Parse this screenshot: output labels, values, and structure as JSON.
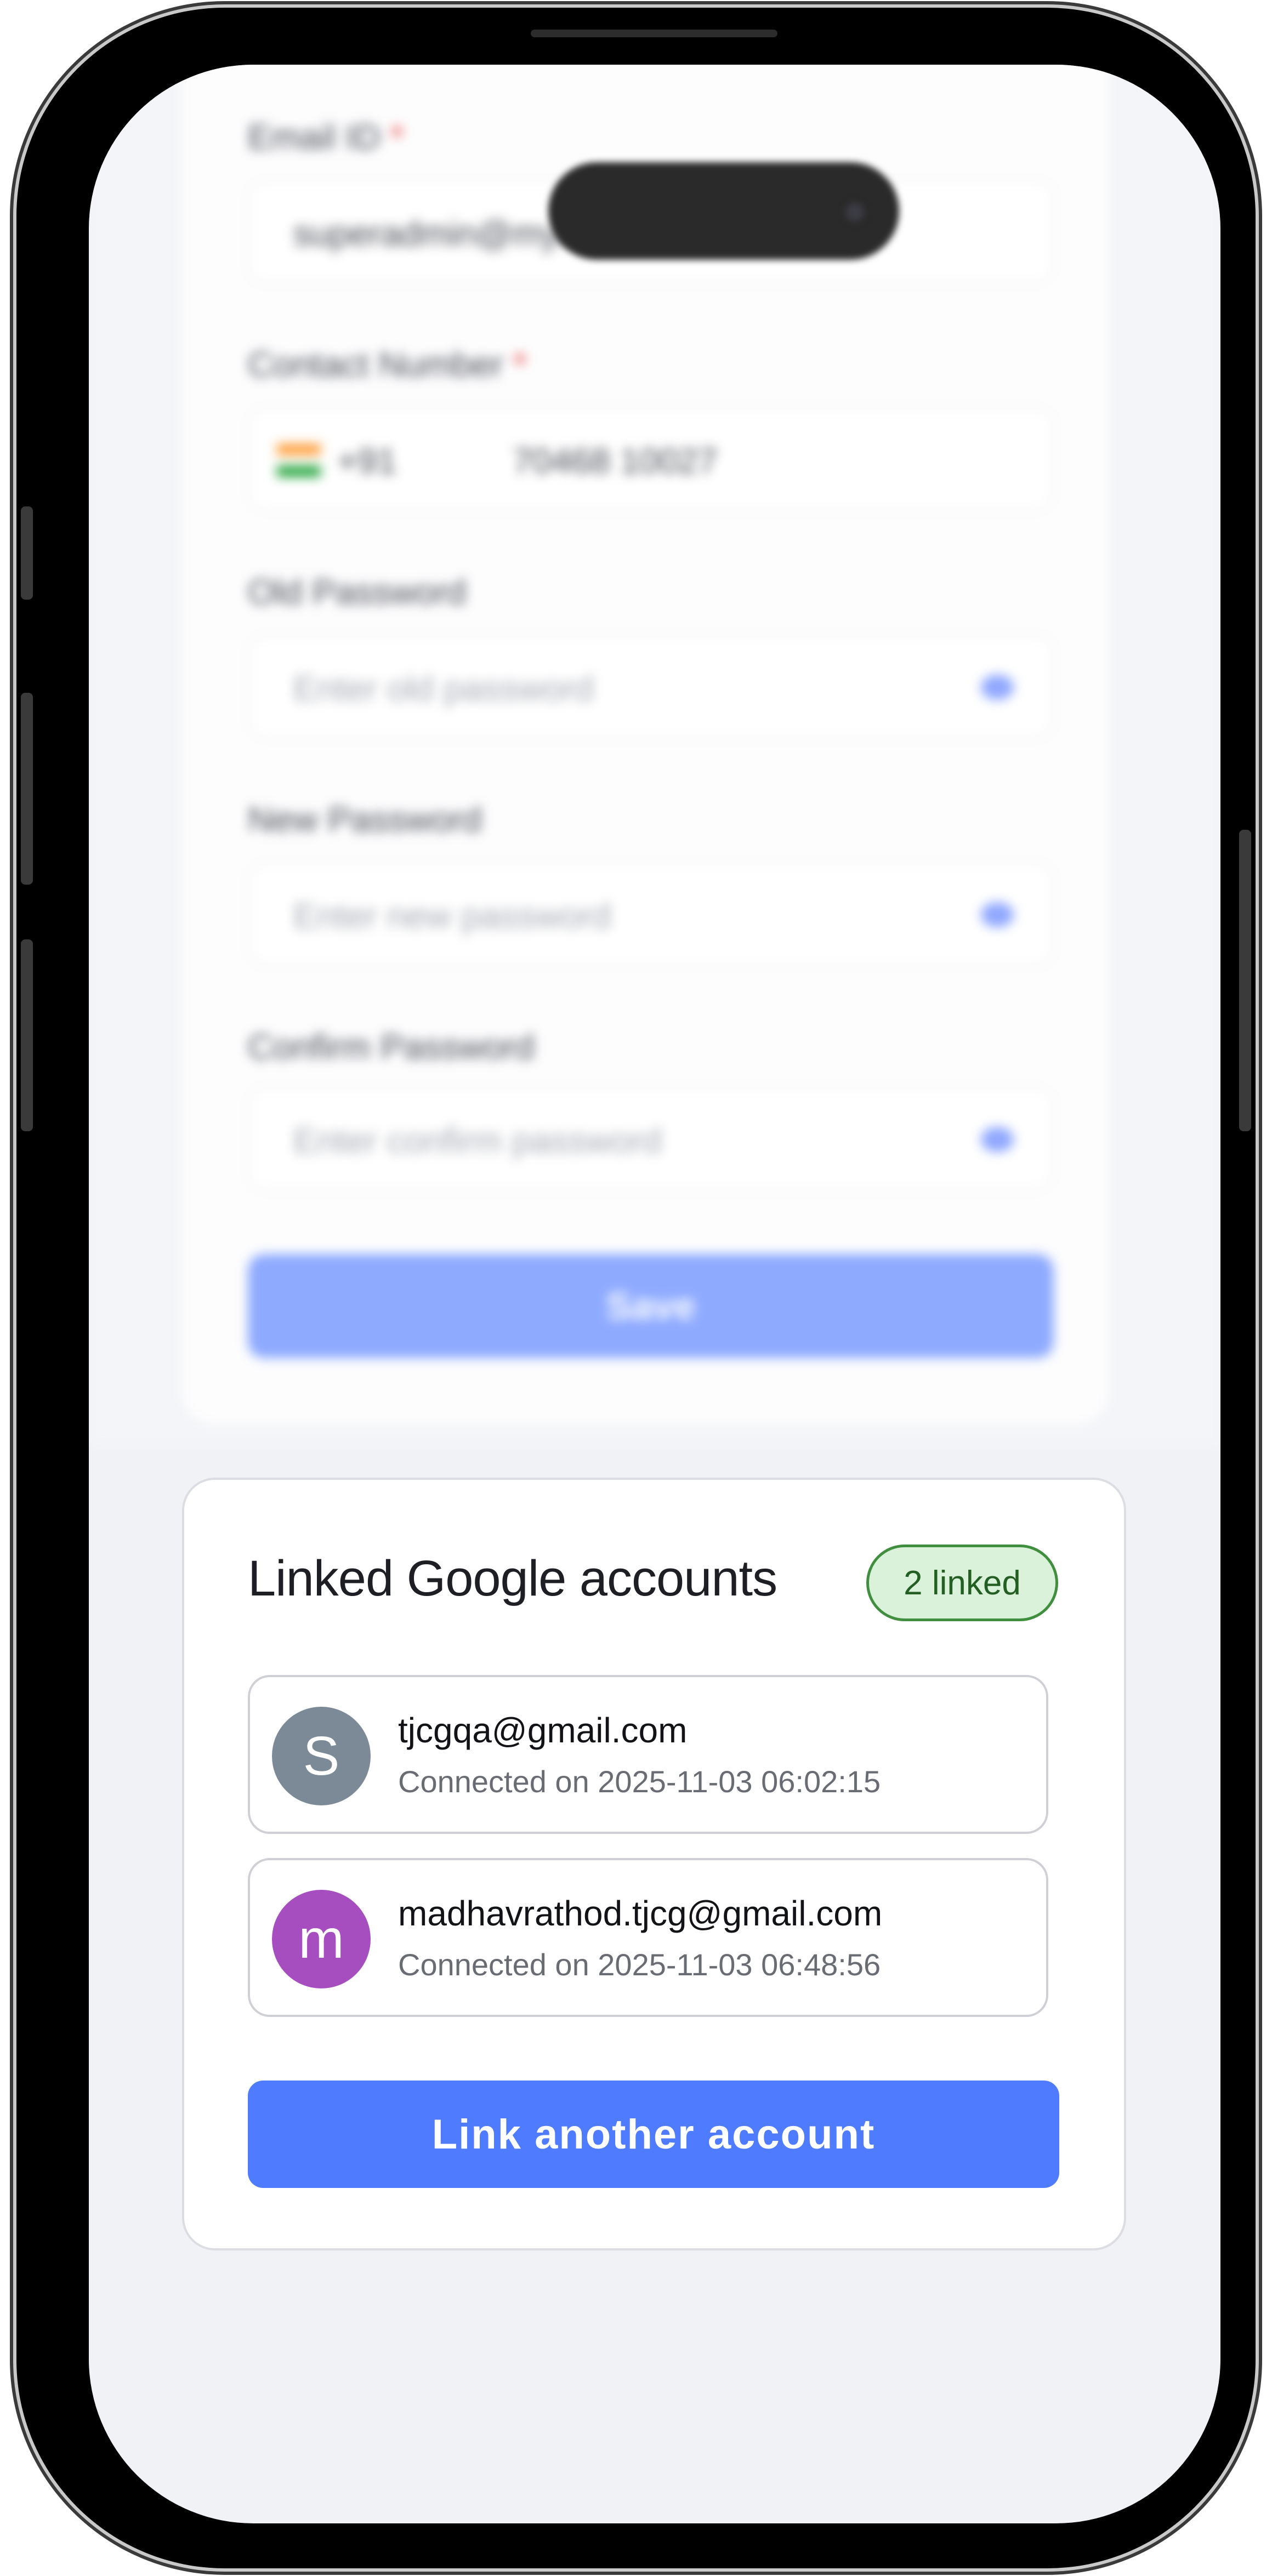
{
  "profile_form": {
    "email_label": "Email ID",
    "email_value": "superadmin@myinkstone.in",
    "contact_label": "Contact Number",
    "required_mark": "*",
    "country_code": "+91",
    "phone_value": "70468 10027",
    "old_password_label": "Old Password",
    "old_password_placeholder": "Enter old password",
    "new_password_label": "New Password",
    "new_password_placeholder": "Enter new password",
    "confirm_password_label": "Confirm Password",
    "confirm_password_placeholder": "Enter confirm password",
    "save_label": "Save"
  },
  "linked_accounts": {
    "title": "Linked Google accounts",
    "badge": "2 linked",
    "accounts": [
      {
        "initial": "S",
        "email": "tjcgqa@gmail.com",
        "connected": "Connected on 2025-11-03 06:02:15",
        "avatar_color": "#7b8a96"
      },
      {
        "initial": "m",
        "email": "madhavrathod.tjcg@gmail.com",
        "connected": "Connected on 2025-11-03 06:48:56",
        "avatar_color": "#a64dbf"
      }
    ],
    "link_button": "Link another account"
  },
  "colors": {
    "primary": "#4f7cff",
    "badge_bg": "#d9f2d9",
    "badge_border": "#3f8f3f",
    "screen_bg": "#f1f2f6"
  }
}
